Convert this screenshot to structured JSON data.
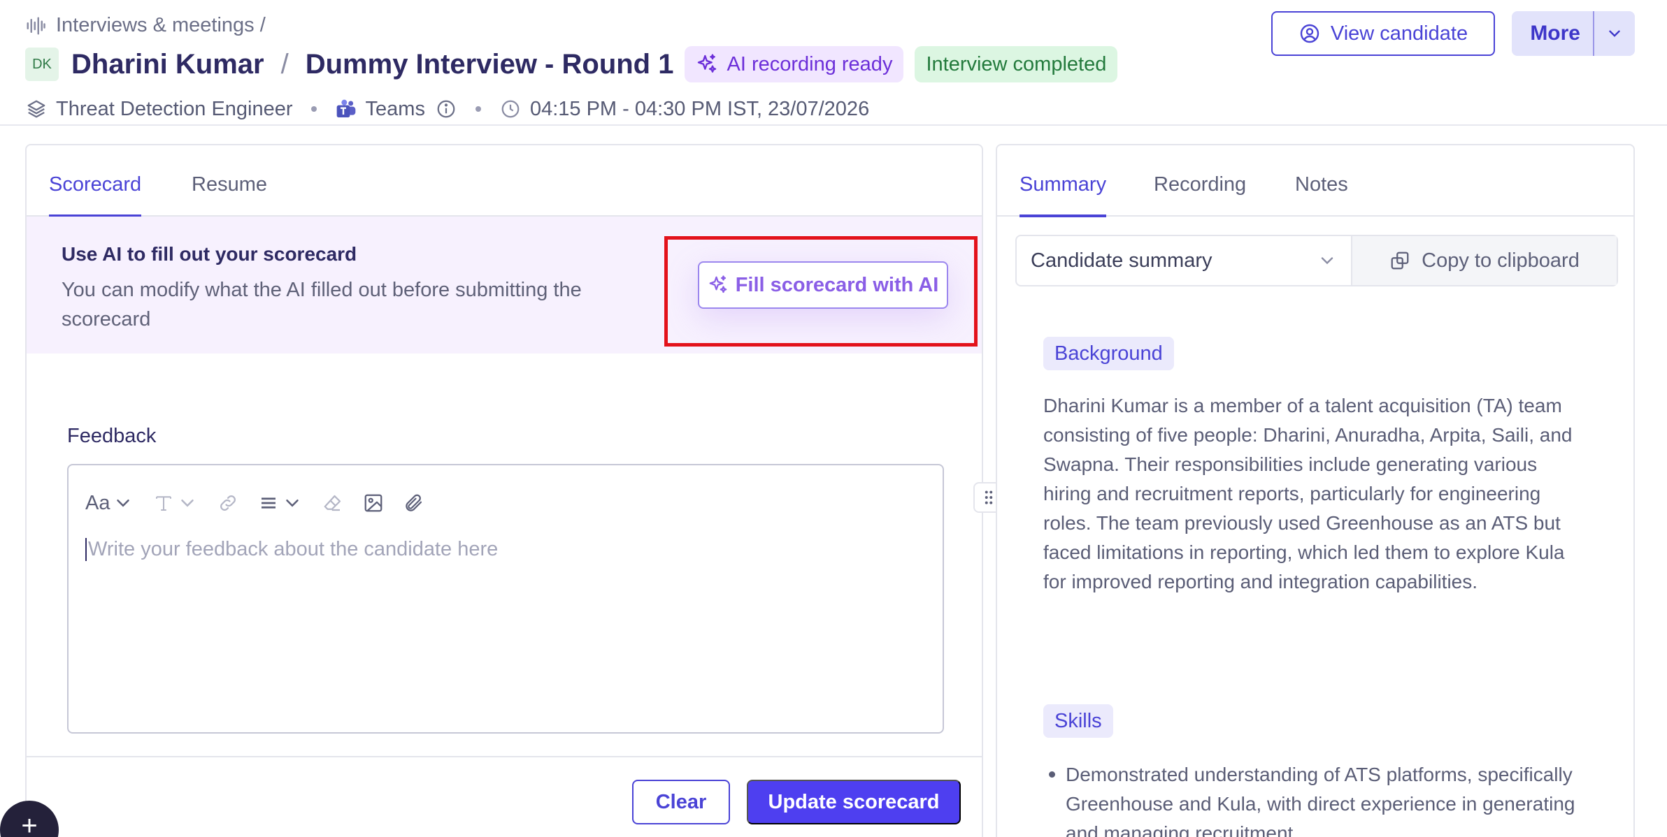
{
  "header": {
    "breadcrumb": "Interviews & meetings /",
    "avatar_initials": "DK",
    "candidate_name": "Dharini Kumar",
    "separator": "/",
    "interview_name": "Dummy Interview - Round 1",
    "badge_ai": "AI recording ready",
    "badge_status": "Interview completed",
    "role": "Threat Detection Engineer",
    "platform": "Teams",
    "time": "04:15 PM - 04:30 PM IST, 23/07/2026",
    "view_candidate_label": "View candidate",
    "more_label": "More"
  },
  "left": {
    "tabs": [
      "Scorecard",
      "Resume"
    ],
    "active_tab": "Scorecard",
    "ai_banner": {
      "heading": "Use AI to fill out your scorecard",
      "text": "You can modify what the AI filled out before submitting the scorecard",
      "button_label": "Fill scorecard with AI"
    },
    "feedback": {
      "label": "Feedback",
      "toolbar_font": "Aa",
      "placeholder": "Write your feedback about the candidate here",
      "value": ""
    },
    "clear_label": "Clear",
    "update_label": "Update scorecard"
  },
  "fab_label": "+",
  "right": {
    "tabs": [
      "Summary",
      "Recording",
      "Notes"
    ],
    "active_tab": "Summary",
    "summary_select": "Candidate summary",
    "copy_label": "Copy to clipboard",
    "sections": [
      {
        "title": "Background",
        "text": "Dharini Kumar is a member of a talent acquisition (TA) team consisting of five people: Dharini, Anuradha, Arpita, Saili, and Swapna. Their responsibilities include generating various hiring and recruitment reports, particularly for engineering roles. The team previously used Greenhouse as an ATS but faced limitations in reporting, which led them to explore Kula for improved reporting and integration capabilities."
      },
      {
        "title": "Skills",
        "items": [
          "Demonstrated understanding of ATS platforms, specifically Greenhouse and Kula, with direct experience in generating and managing recruitment"
        ]
      }
    ]
  },
  "colors": {
    "accent": "#4a43d6",
    "primary_button": "#4e3ff0",
    "highlight_box": "#e3121b",
    "ai_badge_bg": "#f1e6ff",
    "done_badge_bg": "#dcf6e2"
  },
  "icons": [
    "waveform-icon",
    "layers-icon",
    "teams-icon",
    "info-icon",
    "clock-icon",
    "user-circle-icon",
    "chevron-down-icon",
    "sparkles-icon",
    "text-size-icon",
    "link-icon",
    "align-icon",
    "eraser-icon",
    "image-icon",
    "paperclip-icon",
    "drag-handle-icon",
    "copy-icon",
    "plus-icon"
  ]
}
